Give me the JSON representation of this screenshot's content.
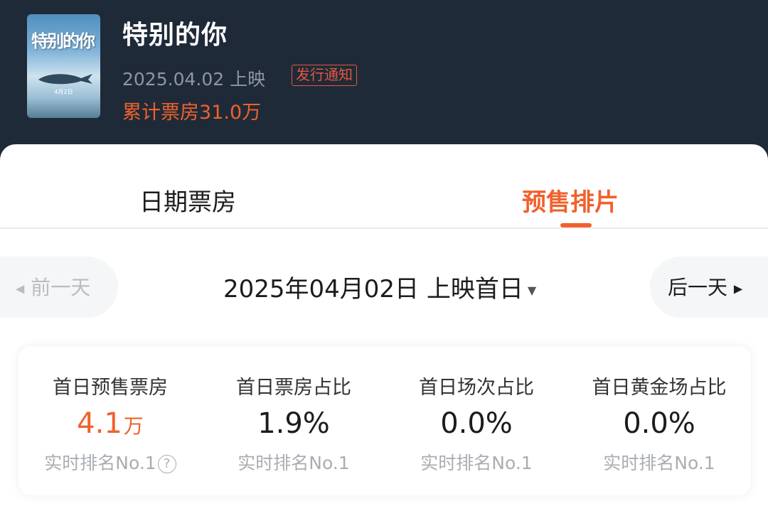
{
  "movie": {
    "title": "特别的你",
    "release_date": "2025.04.02 上映",
    "notice_badge": "发行通知",
    "total_box_office": "累计票房31.0万",
    "poster": {
      "title_text": "特别的你",
      "date_text": "4月2日"
    }
  },
  "tabs": [
    {
      "label": "日期票房",
      "active": false
    },
    {
      "label": "预售排片",
      "active": true
    }
  ],
  "date_nav": {
    "prev_label": "前一天",
    "next_label": "后一天",
    "current_date": "2025年04月02日 上映首日",
    "prev_arrow": "◀",
    "next_arrow": "▶",
    "dropdown_icon": "▼"
  },
  "stats": [
    {
      "label": "首日预售票房",
      "value": "4.1",
      "unit": "万",
      "rank": "实时排名No.1",
      "help": "?"
    },
    {
      "label": "首日票房占比",
      "value": "1.9%",
      "unit": "",
      "rank": "实时排名No.1"
    },
    {
      "label": "首日场次占比",
      "value": "0.0%",
      "unit": "",
      "rank": "实时排名No.1"
    },
    {
      "label": "首日黄金场占比",
      "value": "0.0%",
      "unit": "",
      "rank": "实时排名No.1"
    }
  ],
  "colors": {
    "accent": "#f0612c",
    "header_bg": "#1f2a38",
    "badge": "#e2583e"
  }
}
